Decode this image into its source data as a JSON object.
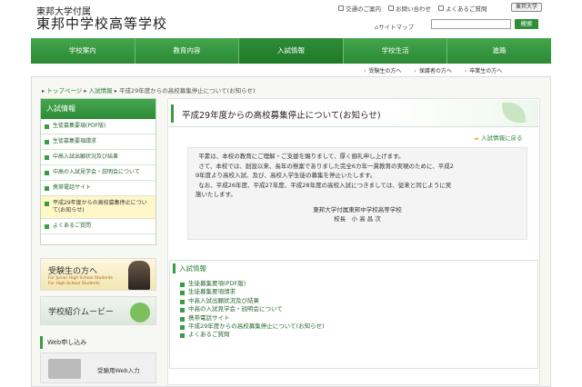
{
  "header": {
    "school_sub": "東邦大学付属",
    "school_name": "東邦中学校高等学校",
    "links": [
      "交通のご案内",
      "お問い合わせ",
      "よくあるご質問"
    ],
    "university_button": "東邦大学",
    "sitemap": "サイトマップ",
    "search_placeholder": "",
    "search_button": "検索"
  },
  "nav": {
    "items": [
      "学校案内",
      "教育内容",
      "入試情報",
      "学校生活",
      "進路"
    ],
    "active": 2
  },
  "subnav": [
    "受験生の方へ",
    "保護者の方へ",
    "卒業生の方へ"
  ],
  "breadcrumb": {
    "home": "トップページ",
    "section": "入試情報",
    "current": "平成29年度からの高校募集停止について(お知らせ)"
  },
  "sidebar": {
    "title": "入試情報",
    "items": [
      {
        "label": "生徒募集要項(PDF版)"
      },
      {
        "label": "生徒募集要項請求"
      },
      {
        "label": "中高入試出願状況及び結果"
      },
      {
        "label": "中高の入試見学会・説明会について"
      },
      {
        "label": "携帯電話サイト"
      },
      {
        "label": "平成29年度からの高校募集停止について(お知らせ)"
      },
      {
        "label": "よくあるご質問"
      }
    ]
  },
  "banners": {
    "applicant": {
      "title": "受験生の方へ",
      "sub1": "For Junior High School Students",
      "sub2": "For High School Students"
    },
    "movie": {
      "title": "学校紹介ムービー"
    },
    "web": {
      "heading": "Web申し込み",
      "label": "受験用Web入力"
    }
  },
  "page": {
    "title": "平成29年度からの高校募集停止について(お知らせ)",
    "back_link": "入試情報に戻る",
    "notice": [
      "平素は、本校の教育にご理解・ご支援を賜りまして、厚く御礼申し上げます。",
      "さて、本校では、創設以来、長年の懸案でありました完全6カ年一貫教育の実現のために、平成2",
      "9年度より高校入試、及び、高校入学生徒の募集を停止いたします。",
      "なお、平成26年度、平成27年度、平成28年度の高校入試につきましては、従来と同じように実",
      "施いたします。"
    ],
    "signature1": "東邦大学付属東邦中学校高等学校",
    "signature2": "校長　小 高 昌 次"
  },
  "section_list": {
    "title": "入試情報",
    "items": [
      "生徒募集要項(PDF版)",
      "生徒募集要項請求",
      "中高入試出願状況及び結果",
      "中高の入試見学会・説明会について",
      "携帯電話サイト",
      "平成29年度からの高校募集停止について(お知らせ)",
      "よくあるご質問"
    ]
  }
}
